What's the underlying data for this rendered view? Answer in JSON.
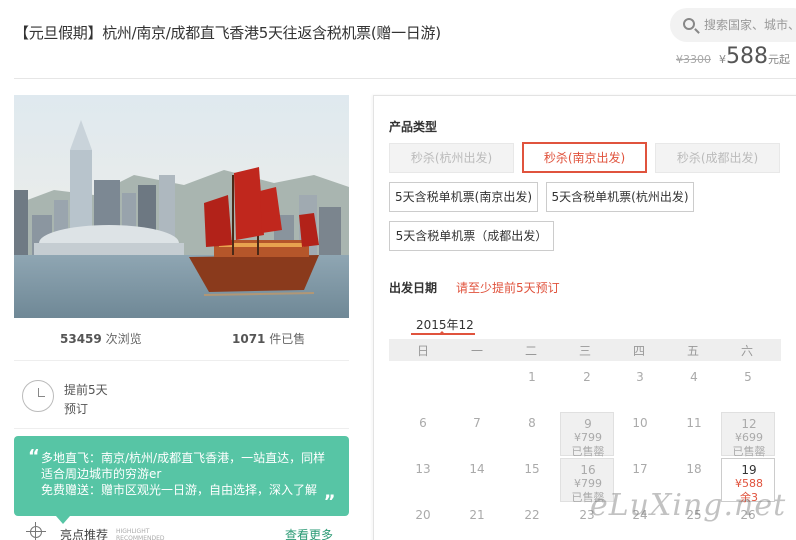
{
  "header": {
    "title": "【元旦假期】杭州/南京/成都直飞香港5天往返含税机票(赠一日游)",
    "search_placeholder": "搜索国家、城市、",
    "old_price": "¥3300",
    "currency": "¥",
    "price": "588",
    "price_unit": "元起"
  },
  "left": {
    "views_count": "53459",
    "views_label": "次浏览",
    "sold_count": "1071",
    "sold_label": "件已售",
    "advance_line1": "提前5天",
    "advance_line2": "预订",
    "promo_text": "多地直飞：南京/杭州/成都直飞香港，一站直达，同样适合周边城市的穷游er\n免费赠送：赠市区观光一日游，自由选择，深入了解",
    "quote_open": "“",
    "quote_close": "„",
    "highlight_label": "亮点推荐",
    "highlight_en": "HIGHLIGHT RECOMMENDED",
    "see_more": "查看更多"
  },
  "panel": {
    "type_label": "产品类型",
    "options": [
      {
        "label": "秒杀(杭州出发)",
        "state": "disabled"
      },
      {
        "label": "秒杀(南京出发)",
        "state": "selected"
      },
      {
        "label": "秒杀(成都出发)",
        "state": "disabled"
      },
      {
        "label": "5天含税单机票(南京出发)",
        "state": "normal"
      },
      {
        "label": "5天含税单机票(杭州出发)",
        "state": "normal"
      },
      {
        "label": "5天含税单机票（成都出发）",
        "state": "normal"
      }
    ],
    "date_label": "出发日期",
    "date_note": "请至少提前5天预订",
    "month": "2015年12",
    "weekdays": [
      "日",
      "一",
      "二",
      "三",
      "四",
      "五",
      "六"
    ],
    "days": [
      {
        "num": "1"
      },
      {
        "num": "2"
      },
      {
        "num": "3"
      },
      {
        "num": "4"
      },
      {
        "num": "5"
      },
      {
        "num": "6"
      },
      {
        "num": "7"
      },
      {
        "num": "8"
      },
      {
        "num": "9",
        "price": "¥799",
        "status": "已售罄"
      },
      {
        "num": "10"
      },
      {
        "num": "11"
      },
      {
        "num": "12",
        "price": "¥699",
        "status": "已售罄"
      },
      {
        "num": "13"
      },
      {
        "num": "14"
      },
      {
        "num": "15"
      },
      {
        "num": "16",
        "price": "¥799",
        "status": "已售罄"
      },
      {
        "num": "17"
      },
      {
        "num": "18"
      },
      {
        "num": "19",
        "price": "¥588",
        "status": "余3",
        "available": true
      },
      {
        "num": "20"
      },
      {
        "num": "21"
      },
      {
        "num": "22"
      },
      {
        "num": "23"
      },
      {
        "num": "24"
      },
      {
        "num": "25"
      },
      {
        "num": "26"
      }
    ]
  },
  "watermark": "eLuXing.net"
}
